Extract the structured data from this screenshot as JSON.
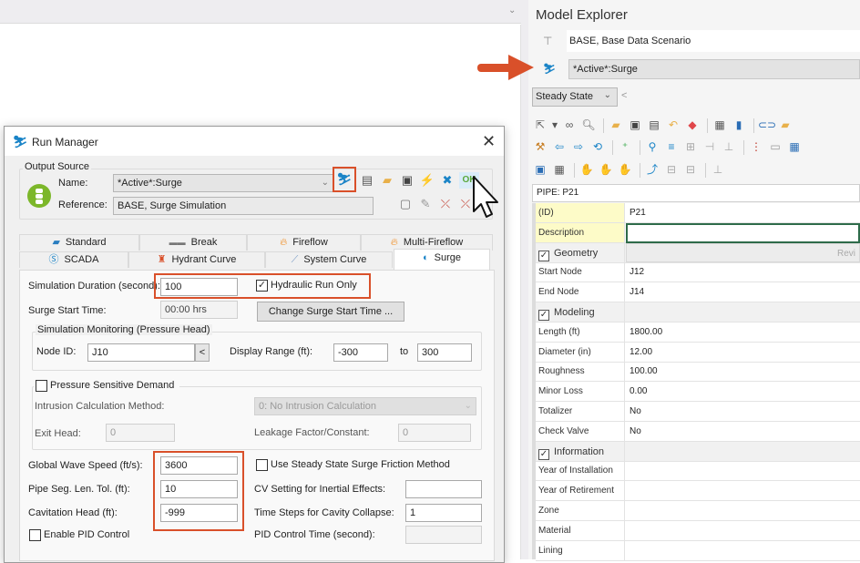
{
  "colors": {
    "accent_red": "#d9502a",
    "run_icon_blue": "#1a84c7",
    "traffic_green": "#7cb72a",
    "description_yellow": "#fdfbc8"
  },
  "run_manager": {
    "title": "Run Manager",
    "title_icon": "run-icon",
    "close_icon": "✕",
    "output_source": {
      "group_label": "Output Source",
      "name_label": "Name:",
      "name_value": "*Active*:Surge",
      "reference_label": "Reference:",
      "reference_value": "BASE, Surge Simulation",
      "toolbar_icons": [
        "run-icon",
        "report-icon",
        "open-folder-icon",
        "save-icon",
        "compute-icon",
        "clear-results-icon",
        "ok-icon"
      ],
      "ok_label": "OK",
      "reference_icons": [
        "new-icon",
        "edit-icon",
        "delete-icon",
        "delete-all-icon"
      ]
    },
    "tabs_row1": [
      {
        "label": "Standard",
        "icon": "folder-icon"
      },
      {
        "label": "Break",
        "icon": "break-icon"
      },
      {
        "label": "Fireflow",
        "icon": "flame-icon"
      },
      {
        "label": "Multi-Fireflow",
        "icon": "multi-flame-icon"
      }
    ],
    "tabs_row2": [
      {
        "label": "SCADA",
        "icon": "scada-icon"
      },
      {
        "label": "Hydrant Curve",
        "icon": "hydrant-icon"
      },
      {
        "label": "System Curve",
        "icon": "curve-icon"
      },
      {
        "label": "Surge",
        "icon": "surge-icon",
        "active": true
      }
    ],
    "surge": {
      "sim_duration_label": "Simulation Duration (second):",
      "sim_duration_value": "100",
      "hydraulic_only_label": "Hydraulic Run Only",
      "hydraulic_only_checked": true,
      "surge_start_label": "Surge Start Time:",
      "surge_start_value": "00:00 hrs",
      "change_start_button": "Change Surge Start Time ...",
      "monitoring": {
        "group_label": "Simulation Monitoring (Pressure Head)",
        "node_label": "Node ID:",
        "node_value": "J10",
        "pick_button": "<",
        "range_label": "Display Range (ft):",
        "range_from": "-300",
        "to_label": "to",
        "range_to": "300"
      },
      "pressure_sensitive": {
        "label": "Pressure Sensitive Demand",
        "checked": false,
        "intrusion_label": "Intrusion Calculation Method:",
        "intrusion_value": "0: No Intrusion Calculation",
        "exit_head_label": "Exit Head:",
        "exit_head_value": "0",
        "leakage_label": "Leakage Factor/Constant:",
        "leakage_value": "0"
      },
      "wave_speed_label": "Global Wave Speed (ft/s):",
      "wave_speed_value": "3600",
      "pipe_seg_label": "Pipe Seg. Len. Tol. (ft):",
      "pipe_seg_value": "10",
      "cavitation_label": "Cavitation Head (ft):",
      "cavitation_value": "-999",
      "pid_label": "Enable PID Control",
      "pid_checked": false,
      "steady_friction_label": "Use Steady State Surge Friction Method",
      "steady_friction_checked": false,
      "cv_label": "CV Setting for Inertial Effects:",
      "cv_value": "",
      "cavity_collapse_label": "Time Steps for Cavity Collapse:",
      "cavity_collapse_value": "1",
      "pid_time_label": "PID Control Time (second):",
      "pid_time_value": ""
    }
  },
  "model_explorer": {
    "title": "Model Explorer",
    "scenario": "BASE, Base Data Scenario",
    "active_scenario": "*Active*:Surge",
    "time_mode": "Steady State",
    "back_glyph": "<",
    "selected_element": "PIPE: P21",
    "properties": [
      {
        "key": "(ID)",
        "value": "P21",
        "type": "yellow"
      },
      {
        "key": "Description",
        "value": "",
        "type": "yellow-focus"
      },
      {
        "key": "Geometry",
        "value": "Revi",
        "type": "category"
      },
      {
        "key": "Start Node",
        "value": "J12"
      },
      {
        "key": "End Node",
        "value": "J14"
      },
      {
        "key": "Modeling",
        "value": "",
        "type": "category"
      },
      {
        "key": "Length (ft)",
        "value": "1800.00"
      },
      {
        "key": "Diameter (in)",
        "value": "12.00"
      },
      {
        "key": "Roughness",
        "value": "100.00"
      },
      {
        "key": "Minor Loss",
        "value": "0.00"
      },
      {
        "key": "Totalizer",
        "value": "No"
      },
      {
        "key": "Check Valve",
        "value": "No"
      },
      {
        "key": "Information",
        "value": "",
        "type": "category"
      },
      {
        "key": "Year of Installation",
        "value": ""
      },
      {
        "key": "Year of Retirement",
        "value": ""
      },
      {
        "key": "Zone",
        "value": ""
      },
      {
        "key": "Material",
        "value": ""
      },
      {
        "key": "Lining",
        "value": ""
      }
    ]
  }
}
